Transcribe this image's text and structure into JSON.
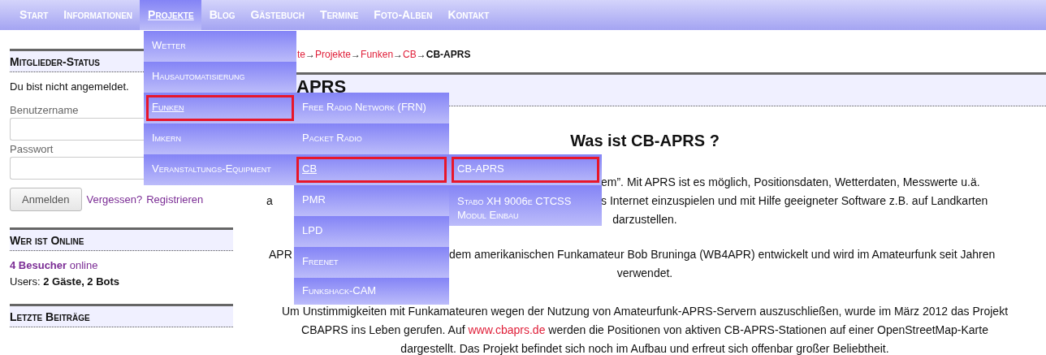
{
  "nav": [
    {
      "label": "Start",
      "selected": false
    },
    {
      "label": "Informationen",
      "selected": false
    },
    {
      "label": "Projekte",
      "selected": true
    },
    {
      "label": "Blog",
      "selected": false
    },
    {
      "label": "Gästebuch",
      "selected": false
    },
    {
      "label": "Termine",
      "selected": false
    },
    {
      "label": "Foto-Alben",
      "selected": false
    },
    {
      "label": "Kontakt",
      "selected": false
    }
  ],
  "menus": [
    {
      "items": [
        {
          "label": "Wetter",
          "expanded": false,
          "highlighted": false
        },
        {
          "label": "Hausautomatisierung",
          "expanded": false,
          "highlighted": false
        },
        {
          "label": "Funken",
          "expanded": true,
          "highlighted": true
        },
        {
          "label": "Imkern",
          "expanded": false,
          "highlighted": false
        },
        {
          "label": "Veranstaltungs-Equipment",
          "expanded": false,
          "highlighted": false
        }
      ]
    },
    {
      "items": [
        {
          "label": "Free Radio Network (FRN)",
          "expanded": false,
          "highlighted": false
        },
        {
          "label": "Packet Radio",
          "expanded": false,
          "highlighted": false
        },
        {
          "label": "CB",
          "expanded": true,
          "highlighted": true
        },
        {
          "label": "PMR",
          "expanded": false,
          "highlighted": false
        },
        {
          "label": "LPD",
          "expanded": false,
          "highlighted": false
        },
        {
          "label": "Freenet",
          "expanded": false,
          "highlighted": false
        },
        {
          "label": "Funkshack-CAM",
          "expanded": false,
          "highlighted": false
        }
      ]
    },
    {
      "items": [
        {
          "label": "CB-APRS",
          "expanded": false,
          "highlighted": true
        },
        {
          "label": "Stabo XH 9006e CTCSS Modul Einbau",
          "expanded": false,
          "highlighted": false
        }
      ]
    }
  ],
  "sidebar": {
    "login": {
      "title": "Mitglieder-Status",
      "status": "Du bist nicht angemeldet.",
      "username_label": "Benutzername",
      "password_label": "Passwort",
      "button": "Anmelden",
      "links": [
        "Vergessen?",
        "Registrieren"
      ]
    },
    "online": {
      "title": "Wer ist Online",
      "visitors": "**4 Besucher** online",
      "users": "Users: **2 Gäste, 2 Bots**"
    },
    "recent": {
      "title": "Letzte Beiträge"
    }
  },
  "breadcrumb": {
    "separator": "→",
    "items": [
      {
        "label": "te",
        "current": false
      },
      {
        "label": "Projekte",
        "current": false
      },
      {
        "label": "Funken",
        "current": false
      },
      {
        "label": "CB",
        "current": false
      },
      {
        "label": "CB-APRS",
        "current": true
      }
    ]
  },
  "page_title": "APRS",
  "heading": "Was ist CB-APRS ?",
  "paragraphs": [
    {
      "kind": "lines",
      "lines": [
        {
          "right": "em”. Mit APRS ist es möglich, Positionsdaten, Wetterdaten, Messwerte u.ä."
        },
        {
          "left": "a",
          "right": "s Internet einzuspielen und mit Hilfe geeigneter Software z.B. auf Landkarten"
        },
        {
          "center": "darzustellen."
        }
      ]
    },
    {
      "kind": "lines",
      "lines": [
        {
          "left": "APR",
          "right": "dem amerikanischen Funkamateur Bob Bruninga (WB4APR) entwickelt und wird im Amateurfunk seit Jahren"
        },
        {
          "center": "verwendet."
        }
      ]
    },
    {
      "kind": "text",
      "segments": [
        {
          "text": "Um Unstimmigkeiten mit Funkamateuren wegen der Nutzung von Amateurfunk-APRS-Servern auszuschließen, wurde im März 2012 das Projekt CBAPRS ins Leben gerufen. Auf ",
          "link": false
        },
        {
          "text": "www.cbaprs.de",
          "link": true
        },
        {
          "text": " werden die Positionen von aktiven CB-APRS-Stationen auf einer OpenStreetMap-Karte dargestellt. Das Projekt befindet sich noch im Aufbau und erfreut sich offenbar großer Beliebtheit.",
          "link": false
        }
      ]
    }
  ]
}
